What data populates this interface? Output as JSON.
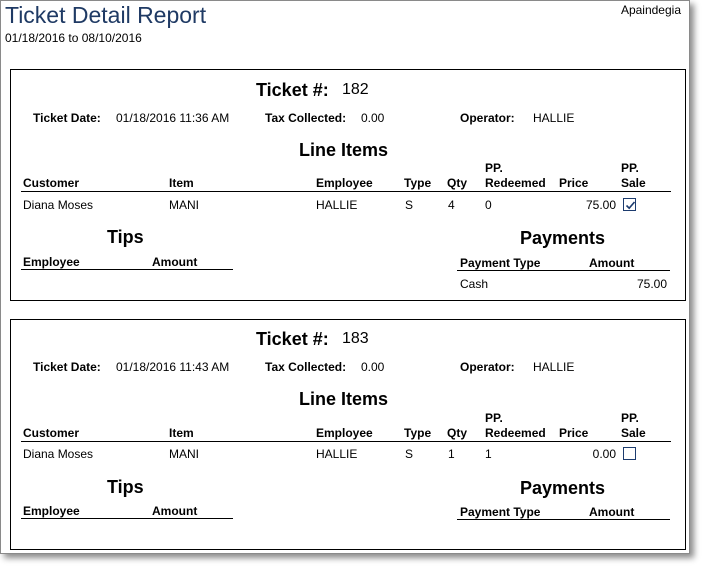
{
  "report": {
    "title": "Ticket Detail Report",
    "date_range": "01/18/2016 to 08/10/2016",
    "company": "Apaindegia"
  },
  "labels": {
    "ticket_num": "Ticket #:",
    "ticket_date": "Ticket Date:",
    "tax_collected": "Tax Collected:",
    "operator": "Operator:",
    "line_items": "Line Items",
    "tips": "Tips",
    "payments": "Payments"
  },
  "line_item_columns": {
    "customer": "Customer",
    "item": "Item",
    "employee": "Employee",
    "type": "Type",
    "qty": "Qty",
    "pp_redeemed_1": "PP.",
    "pp_redeemed_2": "Redeemed",
    "price": "Price",
    "pp_sale_1": "PP.",
    "pp_sale_2": "Sale"
  },
  "tips_columns": {
    "employee": "Employee",
    "amount": "Amount"
  },
  "payment_columns": {
    "payment_type": "Payment Type",
    "amount": "Amount"
  },
  "tickets": [
    {
      "number": "182",
      "date": "01/18/2016 11:36 AM",
      "tax": "0.00",
      "operator": "HALLIE",
      "line_items": [
        {
          "customer": "Diana Moses",
          "item": "MANI",
          "employee": "HALLIE",
          "type": "S",
          "qty": "4",
          "pp_redeemed": "0",
          "price": "75.00",
          "pp_sale": true
        }
      ],
      "payments": [
        {
          "type": "Cash",
          "amount": "75.00"
        }
      ]
    },
    {
      "number": "183",
      "date": "01/18/2016 11:43 AM",
      "tax": "0.00",
      "operator": "HALLIE",
      "line_items": [
        {
          "customer": "Diana Moses",
          "item": "MANI",
          "employee": "HALLIE",
          "type": "S",
          "qty": "1",
          "pp_redeemed": "1",
          "price": "0.00",
          "pp_sale": false
        }
      ],
      "payments": []
    }
  ]
}
